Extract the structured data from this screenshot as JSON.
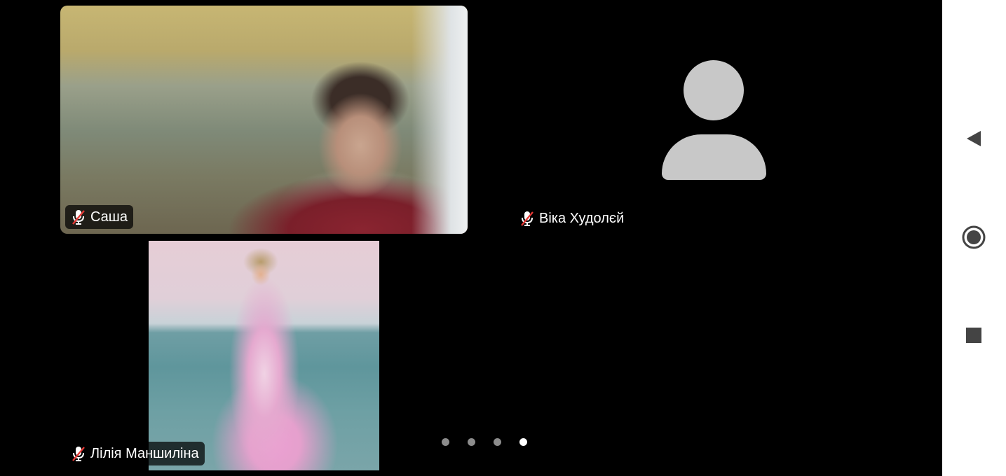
{
  "participants": [
    {
      "name": "Саша",
      "muted": true,
      "video": "camera"
    },
    {
      "name": "Віка Худолєй",
      "muted": true,
      "video": "avatar"
    },
    {
      "name": "Лілія Маншиліна",
      "muted": true,
      "video": "photo"
    }
  ],
  "pagination": {
    "total_pages": 4,
    "current_page": 4
  },
  "icons": {
    "mic": "mic-muted-icon",
    "avatar": "person-icon",
    "back": "back-triangle-icon",
    "home": "home-circle-icon",
    "recents": "recents-square-icon"
  },
  "colors": {
    "background": "#000000",
    "nav_bar": "#ffffff",
    "mute_slash": "#e53935",
    "avatar": "#c8c8c8",
    "dot_inactive": "#8c8c8c",
    "dot_active": "#ffffff"
  }
}
